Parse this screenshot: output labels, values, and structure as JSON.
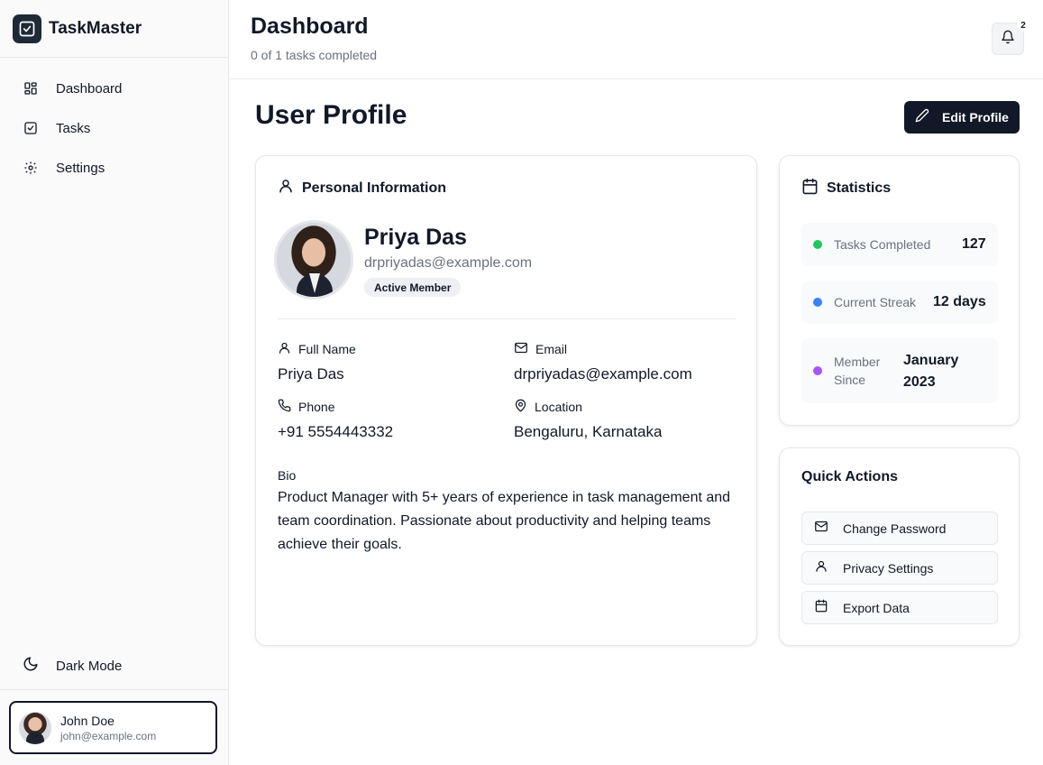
{
  "app": {
    "name": "TaskMaster"
  },
  "sidebar": {
    "items": [
      {
        "label": "Dashboard",
        "icon": "dashboard-grid-icon"
      },
      {
        "label": "Tasks",
        "icon": "checkbox-icon"
      },
      {
        "label": "Settings",
        "icon": "gear-icon"
      }
    ],
    "dark_mode_label": "Dark Mode",
    "user": {
      "name": "John Doe",
      "email": "john@example.com"
    }
  },
  "header": {
    "title": "Dashboard",
    "subtitle": "0 of 1 tasks completed",
    "notification_count": "2"
  },
  "main": {
    "title": "User Profile",
    "edit_button": "Edit Profile"
  },
  "profile": {
    "section_title": "Personal Information",
    "name": "Priya Das",
    "email": "drpriyadas@example.com",
    "badge": "Active Member",
    "fields": {
      "full_name_label": "Full Name",
      "full_name": "Priya Das",
      "email_label": "Email",
      "email": "drpriyadas@example.com",
      "phone_label": "Phone",
      "phone": "+91 5554443332",
      "location_label": "Location",
      "location": "Bengaluru, Karnataka"
    },
    "bio_label": "Bio",
    "bio": "Product Manager with 5+ years of experience in task management and team coordination. Passionate about productivity and helping teams achieve their goals."
  },
  "statistics": {
    "title": "Statistics",
    "items": [
      {
        "label": "Tasks Completed",
        "value": "127",
        "color": "#22c55e"
      },
      {
        "label": "Current Streak",
        "value": "12 days",
        "color": "#3b82f6"
      },
      {
        "label": "Member Since",
        "value": "January 2023",
        "color": "#a855f7"
      }
    ]
  },
  "quick_actions": {
    "title": "Quick Actions",
    "items": [
      {
        "label": "Change Password",
        "icon": "mail-icon"
      },
      {
        "label": "Privacy Settings",
        "icon": "user-icon"
      },
      {
        "label": "Export Data",
        "icon": "calendar-icon"
      }
    ]
  },
  "colors": {
    "primary_dark": "#111827",
    "muted_text": "#6b7280",
    "border": "#e5e7eb",
    "sidebar_bg": "#fafafa"
  }
}
